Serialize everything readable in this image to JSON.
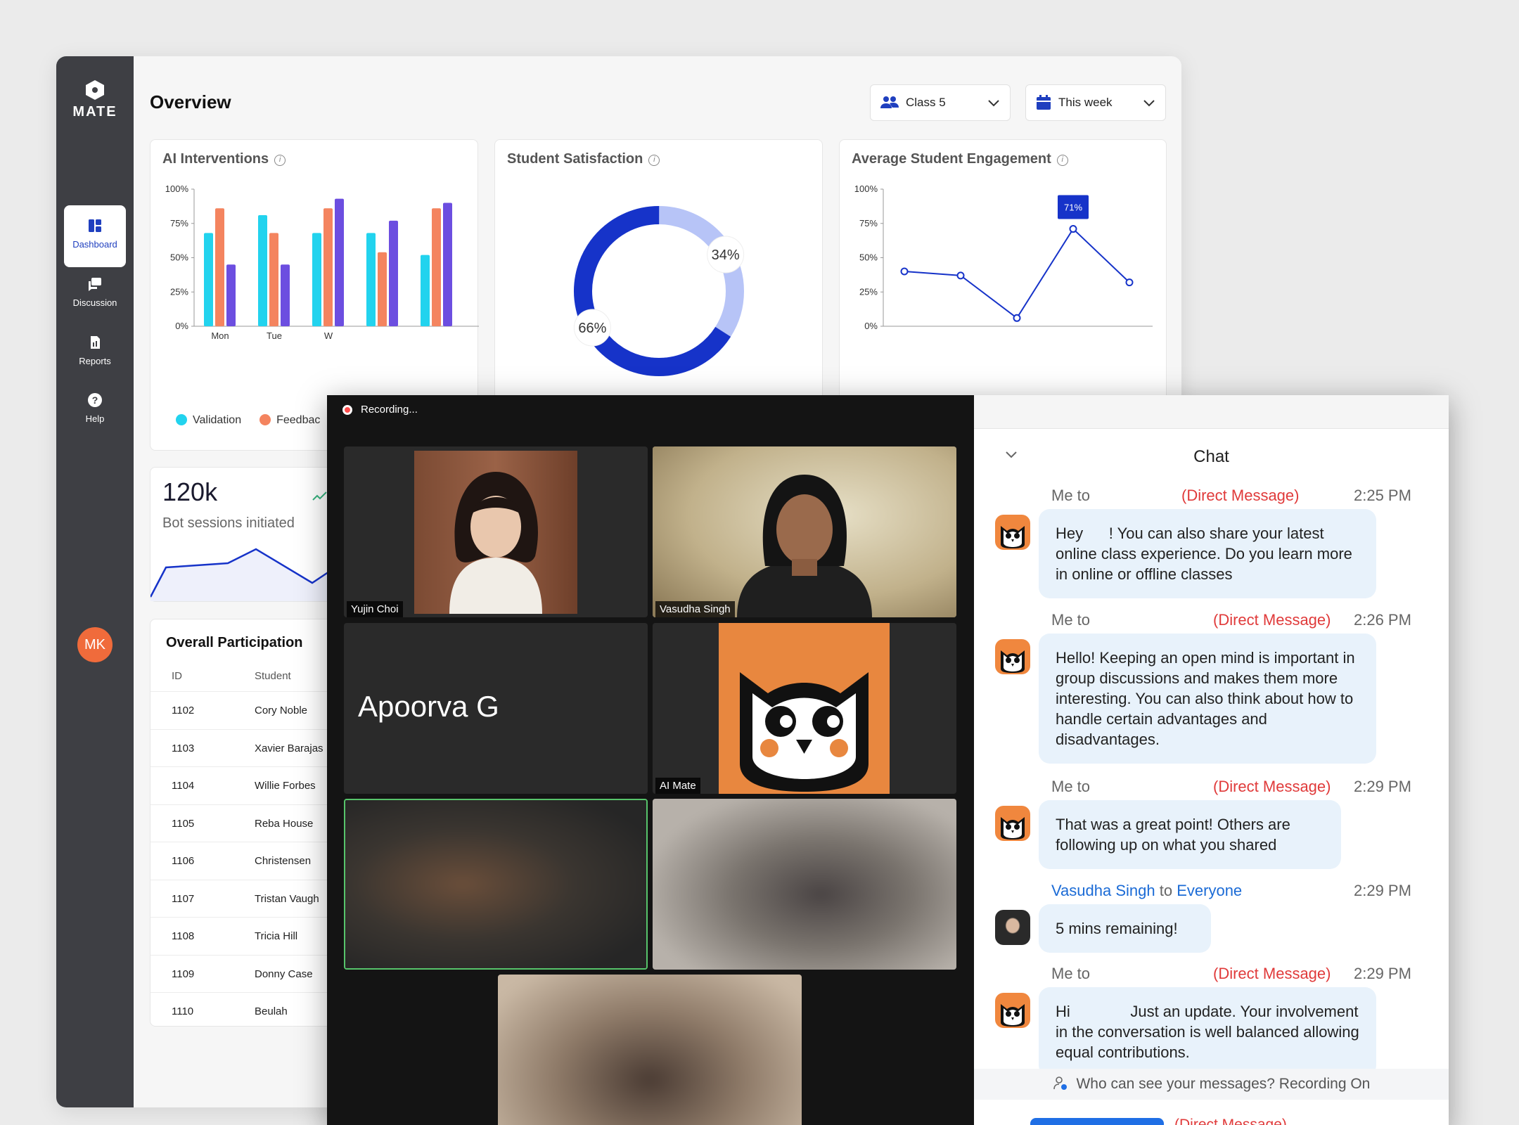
{
  "sidebar": {
    "logo_text": "MATE",
    "items": [
      {
        "label": "Dashboard",
        "icon": "dashboard-icon",
        "active": true
      },
      {
        "label": "Discussion",
        "icon": "chat-bubbles-icon"
      },
      {
        "label": "Reports",
        "icon": "report-icon"
      },
      {
        "label": "Help",
        "icon": "help-icon"
      }
    ],
    "avatar_initials": "MK"
  },
  "header": {
    "title": "Overview",
    "class_select": "Class 5",
    "date_select": "This week"
  },
  "ai_interventions": {
    "title": "AI Interventions",
    "legend": [
      "Validation",
      "Feedbac"
    ],
    "chart_data": {
      "type": "bar",
      "categories": [
        "Mon",
        "Tue",
        "W"
      ],
      "yticks": [
        "100%",
        "75%",
        "50%",
        "25%",
        "0%"
      ],
      "ylim": [
        0,
        100
      ],
      "series": [
        {
          "name": "Validation",
          "color": "#22d3ee",
          "values": [
            68,
            81,
            68,
            68,
            52
          ]
        },
        {
          "name": "Feedbac",
          "color": "#f4845f",
          "values": [
            86,
            68,
            86,
            54,
            86
          ]
        },
        {
          "color": "#6c4ee0",
          "values": [
            45,
            45,
            93,
            77,
            90
          ]
        }
      ]
    }
  },
  "student_satisfaction": {
    "title": "Student Satisfaction",
    "chart_data": {
      "type": "pie",
      "slices": [
        {
          "label": "34%",
          "value": 34,
          "color": "#b7c4f7"
        },
        {
          "label": "66%",
          "value": 66,
          "color": "#1633c9"
        }
      ]
    }
  },
  "avg_engagement": {
    "title": "Average Student Engagement",
    "tooltip": "71%",
    "chart_data": {
      "type": "line",
      "yticks": [
        "100%",
        "75%",
        "50%",
        "25%",
        "0%"
      ],
      "ylim": [
        0,
        100
      ],
      "values": [
        40,
        37,
        6,
        71,
        32
      ],
      "color": "#1633c9"
    }
  },
  "kpi": {
    "value": "120k",
    "label": "Bot sessions initiated"
  },
  "participation": {
    "title": "Overall Participation",
    "columns": [
      "ID",
      "Student"
    ],
    "rows": [
      {
        "id": "1102",
        "name": "Cory Noble"
      },
      {
        "id": "1103",
        "name": "Xavier Barajas"
      },
      {
        "id": "1104",
        "name": "Willie Forbes"
      },
      {
        "id": "1105",
        "name": "Reba House"
      },
      {
        "id": "1106",
        "name": "Christensen"
      },
      {
        "id": "1107",
        "name": "Tristan Vaugh"
      },
      {
        "id": "1108",
        "name": "Tricia Hill"
      },
      {
        "id": "1109",
        "name": "Donny Case"
      },
      {
        "id": "1110",
        "name": "Beulah"
      }
    ]
  },
  "meeting": {
    "recording_label": "Recording...",
    "participants": {
      "p1": "Yujin Choi",
      "p2": "Vasudha Singh",
      "p3": "Apoorva G",
      "p4": "AI Mate"
    }
  },
  "chat": {
    "title": "Chat",
    "messages": [
      {
        "from": "Me to",
        "tag": "(Direct Message)",
        "time": "2:25 PM",
        "text": "Hey      ! You can also share your latest online class experience. Do you learn more in online or offline classes"
      },
      {
        "from": "Me to",
        "tag": "(Direct Message)",
        "time": "2:26 PM",
        "text": "Hello! Keeping an open mind is important in group discussions and makes them more interesting. You can also think about how to handle certain advantages and disadvantages."
      },
      {
        "from": "Me to",
        "tag": "(Direct Message)",
        "time": "2:29 PM",
        "text": "That was a great point! Others are following up on what you shared"
      },
      {
        "sender": "Vasudha Singh",
        "to": "to",
        "recipient": "Everyone",
        "time": "2:29 PM",
        "text": "5 mins remaining!"
      },
      {
        "from": "Me to",
        "tag": "(Direct Message)",
        "time": "2:29 PM",
        "text": "Hi              Just an update. Your involvement in the conversation is well balanced allowing equal contributions."
      }
    ],
    "privacy_note": "Who can see your messages? Recording On",
    "bottom_tag": "(Direct Message)"
  }
}
